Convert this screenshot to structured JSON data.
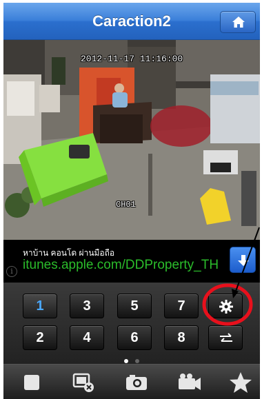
{
  "header": {
    "title": "Caraction2",
    "home_icon": "home-icon"
  },
  "camera": {
    "timestamp": "2012-11-17 11:16:00",
    "channel": "CH01"
  },
  "ad": {
    "line1": "หาบ้าน คอนโด ผ่านมือถือ",
    "line2": "itunes.apple.com/DDProperty_TH",
    "info_glyph": "i",
    "info_icon": "info-icon",
    "arrow_icon": "download-arrow-icon"
  },
  "channels": [
    {
      "label": "1",
      "selected": true
    },
    {
      "label": "3"
    },
    {
      "label": "5"
    },
    {
      "label": "7"
    },
    {
      "label": "2"
    },
    {
      "label": "4"
    },
    {
      "label": "6"
    },
    {
      "label": "8"
    }
  ],
  "panel_icons": {
    "settings": "gear-icon",
    "switch": "swap-arrows-icon"
  },
  "page_dots": {
    "count": 2,
    "active": 0
  },
  "toolbar": [
    "stop-icon",
    "close-view-icon",
    "camera-snapshot-icon",
    "video-record-icon",
    "favorite-star-icon"
  ],
  "colors": {
    "title_bar": "#2b6fce",
    "selected_channel": "#4aa8ff",
    "ad_link": "#2bbd2b",
    "annotation": "#e8101c"
  }
}
